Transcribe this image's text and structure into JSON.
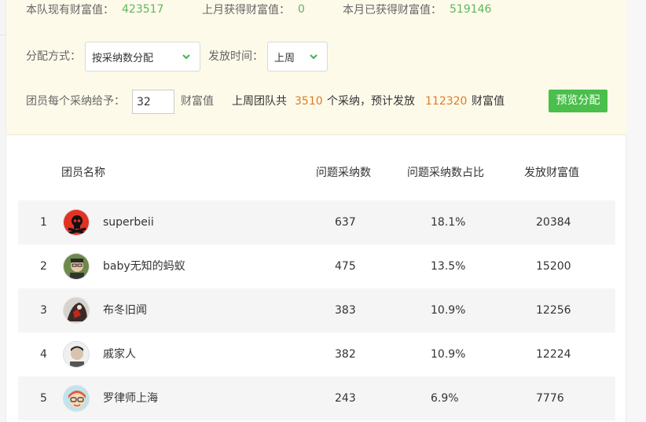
{
  "stats": {
    "current_label": "本队现有财富值：",
    "current_value": "423517",
    "last_month_label": "上月获得财富值：",
    "last_month_value": "0",
    "this_month_label": "本月已获得财富值：",
    "this_month_value": "519146"
  },
  "distribution": {
    "method_label": "分配方式：",
    "method_value": "按采纳数分配",
    "time_label": "发放时间：",
    "time_value": "上周"
  },
  "per_adopt": {
    "label": "团员每个采纳给予：",
    "input_value": "32",
    "unit": "财富值",
    "summary_prefix": "上周团队共",
    "summary_count": "3510",
    "summary_mid": "个采纳，预计发放",
    "summary_total": "112320",
    "summary_unit": "财富值",
    "preview_button": "预览分配"
  },
  "table": {
    "headers": [
      "团员名称",
      "问题采纳数",
      "问题采纳数占比",
      "发放财富值"
    ],
    "rows": [
      {
        "rank": "1",
        "name": "superbeii",
        "count": "637",
        "pct": "18.1%",
        "value": "20384"
      },
      {
        "rank": "2",
        "name": "baby无知的蚂蚁",
        "count": "475",
        "pct": "13.5%",
        "value": "15200"
      },
      {
        "rank": "3",
        "name": "布冬旧闻",
        "count": "383",
        "pct": "10.9%",
        "value": "12256"
      },
      {
        "rank": "4",
        "name": "戚家人",
        "count": "382",
        "pct": "10.9%",
        "value": "12224"
      },
      {
        "rank": "5",
        "name": "罗律师上海",
        "count": "243",
        "pct": "6.9%",
        "value": "7776"
      }
    ]
  },
  "colors": {
    "green": "#5cb85c",
    "orange": "#e07b1f",
    "panel_bg": "#fdfaea",
    "button_green": "#4bbf4b"
  }
}
